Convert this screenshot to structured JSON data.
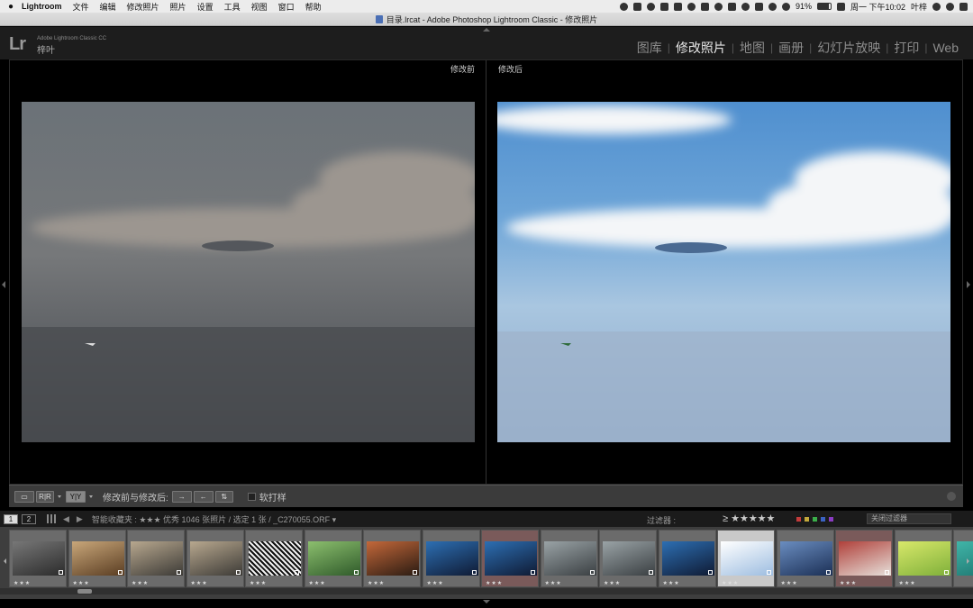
{
  "menubar": {
    "app_name": "Lightroom",
    "items": [
      "文件",
      "编辑",
      "修改照片",
      "照片",
      "设置",
      "工具",
      "视图",
      "窗口",
      "帮助"
    ],
    "battery": "91%",
    "clock": "周一 下午10:02",
    "user": "叶梓"
  },
  "titlebar": {
    "title": "目录.lrcat - Adobe Photoshop Lightroom Classic - 修改照片"
  },
  "identity": {
    "logo": "Lr",
    "product": "Adobe Lightroom Classic CC",
    "user": "梓叶"
  },
  "modules": [
    {
      "label": "图库",
      "active": false
    },
    {
      "label": "修改照片",
      "active": true
    },
    {
      "label": "地图",
      "active": false
    },
    {
      "label": "画册",
      "active": false
    },
    {
      "label": "幻灯片放映",
      "active": false
    },
    {
      "label": "打印",
      "active": false
    },
    {
      "label": "Web",
      "active": false
    }
  ],
  "compare": {
    "before_label": "修改前",
    "after_label": "修改后"
  },
  "toolbar": {
    "view_rr": "R|R",
    "view_yy": "Y|Y",
    "compare_label": "修改前与修改后:",
    "soft_proof_label": "软打样"
  },
  "filmstrip_header": {
    "monitor1": "1",
    "monitor2": "2",
    "source": "智能收藏夹 : ★★★ 优秀   1046 张照片 / 选定 1 张 / _C270055.ORF ▾",
    "filter_label": "过滤器 :",
    "rating_filter": "≥ ★★★★★",
    "filter_select": "关闭过滤器"
  },
  "colors": {
    "label_red": "#c23b3b",
    "label_yellow": "#c2a83b",
    "label_green": "#3bae4a",
    "label_blue": "#3b62c2",
    "label_purple": "#8a3bc2"
  },
  "thumbnails": [
    {
      "kind": "street",
      "stars": "★★★"
    },
    {
      "kind": "interior",
      "stars": "★★★"
    },
    {
      "kind": "market",
      "stars": "★★★"
    },
    {
      "kind": "market",
      "stars": "★★★"
    },
    {
      "kind": "pattern",
      "stars": "★★★"
    },
    {
      "kind": "garden",
      "stars": "★★★"
    },
    {
      "kind": "bridge",
      "stars": "★★★"
    },
    {
      "kind": "night",
      "stars": "★★★"
    },
    {
      "kind": "night",
      "stars": "★★★"
    },
    {
      "kind": "alley",
      "stars": "★★★"
    },
    {
      "kind": "alley",
      "stars": "★★★"
    },
    {
      "kind": "night",
      "stars": "★★★"
    },
    {
      "kind": "sky",
      "stars": "★★★"
    },
    {
      "kind": "harbor",
      "stars": "★★★"
    },
    {
      "kind": "carnival",
      "stars": "★★★"
    },
    {
      "kind": "leaf",
      "stars": "★★★"
    },
    {
      "kind": "teal",
      "stars": ""
    }
  ]
}
